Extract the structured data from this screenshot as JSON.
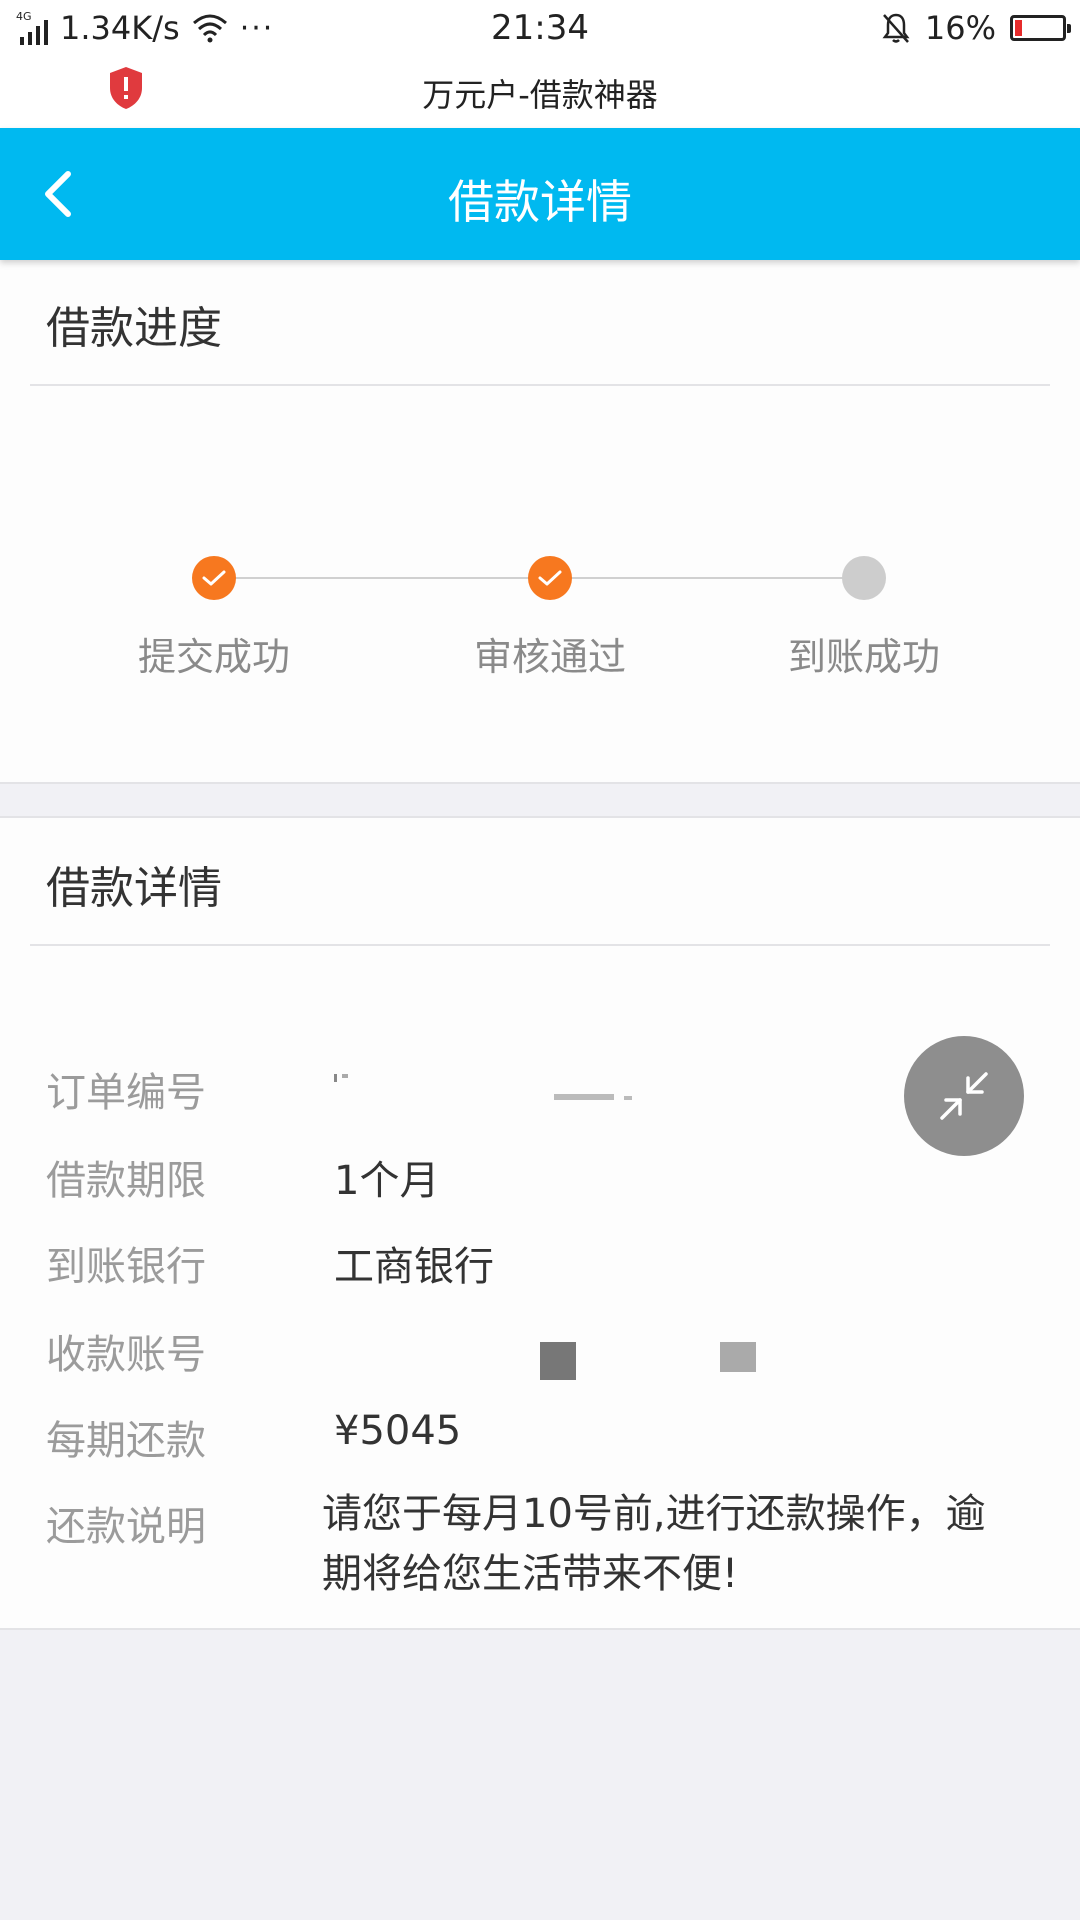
{
  "status_bar": {
    "network": "4G",
    "speed": "1.34K/s",
    "dots": "···",
    "time": "21:34",
    "battery": "16%",
    "battery_level": 0.16
  },
  "app_bar": {
    "title": "万元户-借款神器"
  },
  "header": {
    "title": "借款详情",
    "bg_color": "#00b9f0"
  },
  "progress": {
    "title": "借款进度",
    "steps": [
      {
        "label": "提交成功",
        "done": true
      },
      {
        "label": "审核通过",
        "done": true
      },
      {
        "label": "到账成功",
        "done": false
      }
    ],
    "done_color": "#f7781f",
    "pending_color": "#cdcdcd"
  },
  "details": {
    "title": "借款详情",
    "rows": [
      {
        "label": "订单编号",
        "value": ""
      },
      {
        "label": "借款期限",
        "value": "1个月"
      },
      {
        "label": "到账银行",
        "value": "工商银行"
      },
      {
        "label": "收款账号",
        "value": ""
      },
      {
        "label": "每期还款",
        "value": "¥5045"
      },
      {
        "label": "还款说明",
        "value": "请您于每月10号前,进行还款操作，逾期将给您生活带来不便!"
      }
    ]
  }
}
